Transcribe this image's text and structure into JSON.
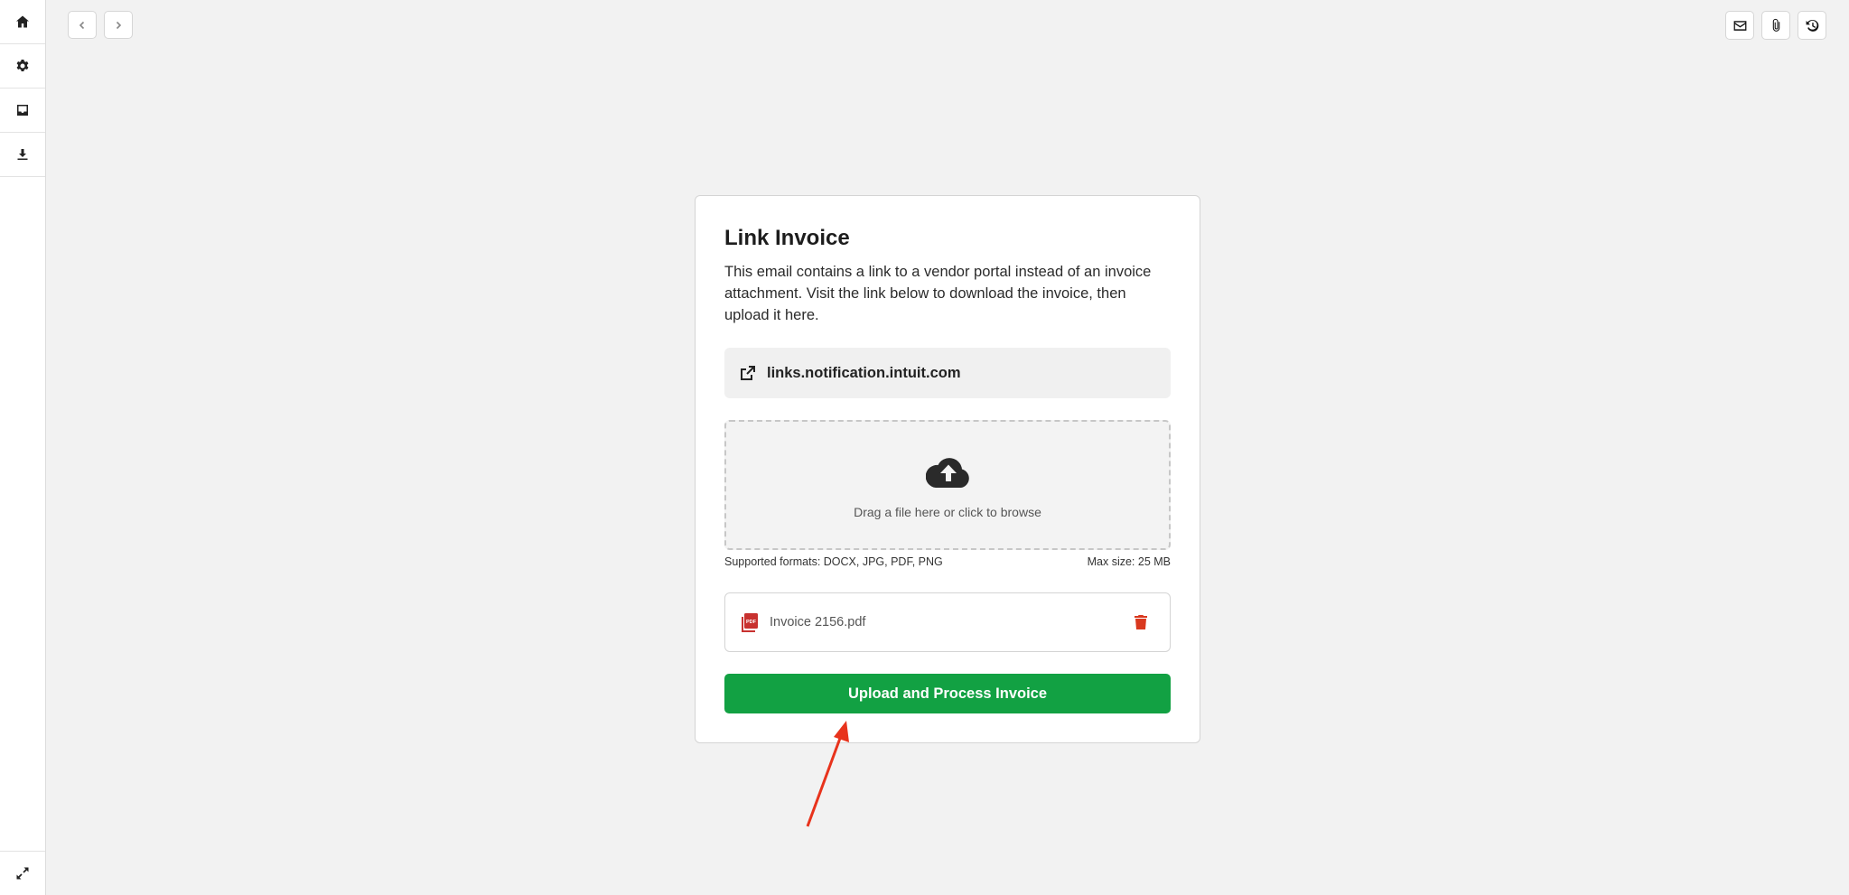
{
  "sidebar": {
    "items": [
      {
        "name": "home-icon"
      },
      {
        "name": "gear-icon"
      },
      {
        "name": "inbox-icon"
      },
      {
        "name": "download-icon"
      }
    ],
    "bottom": {
      "name": "expand-icon"
    }
  },
  "toolbar": {
    "back_icon": "chevron-left-icon",
    "forward_icon": "chevron-right-icon",
    "right_icons": [
      "mail-icon",
      "paperclip-icon",
      "history-icon"
    ]
  },
  "card": {
    "title": "Link Invoice",
    "description": "This email contains a link to a vendor portal instead of an invoice attachment. Visit the link below to download the invoice, then upload it here.",
    "link": {
      "text": "links.notification.intuit.com",
      "icon": "external-link-icon"
    },
    "dropzone": {
      "text": "Drag a file here or click to browse",
      "icon": "cloud-upload-icon"
    },
    "formats": "Supported formats: DOCX, JPG, PDF, PNG",
    "max_size": "Max size: 25 MB",
    "file": {
      "name": "Invoice 2156.pdf",
      "icon": "pdf-file-icon",
      "delete_icon": "trash-icon"
    },
    "submit_label": "Upload and Process Invoice"
  },
  "annotation": {
    "arrow_color": "#e8331c"
  },
  "colors": {
    "accent": "#12a143",
    "danger": "#d9381e",
    "background": "#f2f2f2"
  }
}
